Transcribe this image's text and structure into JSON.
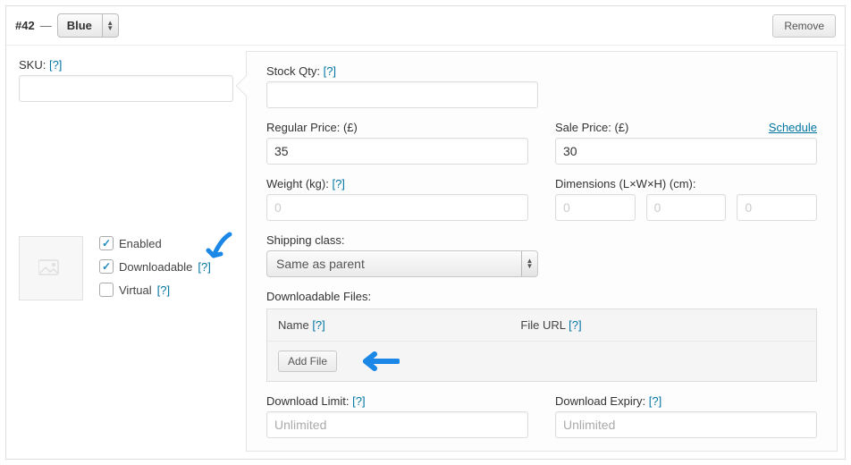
{
  "header": {
    "variation_id": "#42",
    "dash": "—",
    "attribute_selected": "Blue",
    "remove_label": "Remove"
  },
  "left": {
    "sku": {
      "label": "SKU:",
      "help": "[?]",
      "value": ""
    },
    "checks": {
      "enabled": {
        "label": "Enabled",
        "checked": true
      },
      "downloadable": {
        "label": "Downloadable",
        "help": "[?]",
        "checked": true
      },
      "virtual": {
        "label": "Virtual",
        "help": "[?]",
        "checked": false
      }
    }
  },
  "right": {
    "stock_qty": {
      "label": "Stock Qty:",
      "help": "[?]",
      "value": ""
    },
    "regular_price": {
      "label": "Regular Price: (£)",
      "value": "35"
    },
    "sale_price": {
      "label": "Sale Price: (£)",
      "value": "30",
      "schedule": "Schedule"
    },
    "weight": {
      "label": "Weight (kg):",
      "help": "[?]",
      "placeholder": "0",
      "value": ""
    },
    "dimensions": {
      "label": "Dimensions (L×W×H) (cm):",
      "l": "",
      "w": "",
      "h": "",
      "placeholder": "0"
    },
    "shipping_class": {
      "label": "Shipping class:",
      "selected": "Same as parent"
    },
    "downloadable_files": {
      "label": "Downloadable Files:",
      "col_name": "Name",
      "col_url": "File URL",
      "help": "[?]",
      "add_file_label": "Add File"
    },
    "download_limit": {
      "label": "Download Limit:",
      "help": "[?]",
      "placeholder": "Unlimited",
      "value": ""
    },
    "download_expiry": {
      "label": "Download Expiry:",
      "help": "[?]",
      "placeholder": "Unlimited",
      "value": ""
    }
  }
}
